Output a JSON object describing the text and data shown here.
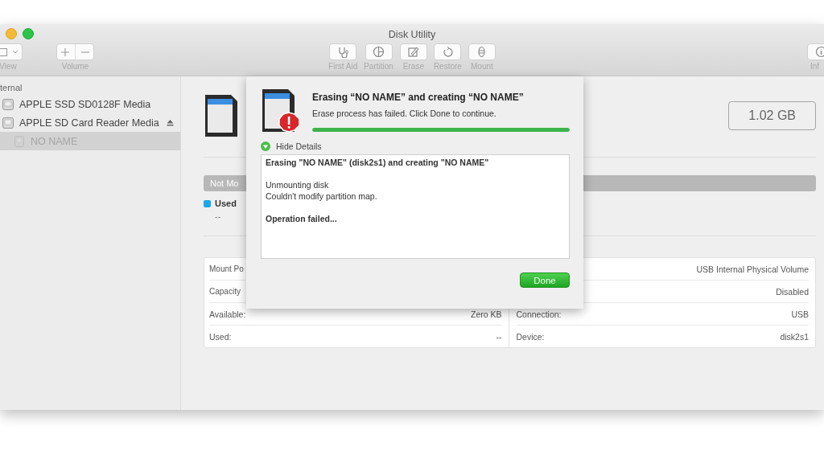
{
  "window": {
    "title": "Disk Utility"
  },
  "toolbar": {
    "left": [
      {
        "kind": "view",
        "label": "View"
      },
      {
        "kind": "volume",
        "label": "Volume"
      }
    ],
    "center": [
      {
        "label": "First Aid"
      },
      {
        "label": "Partition"
      },
      {
        "label": "Erase"
      },
      {
        "label": "Restore"
      },
      {
        "label": "Mount"
      }
    ],
    "right": [
      {
        "label": "Inf"
      }
    ]
  },
  "sidebar": {
    "items": [
      {
        "kind": "header",
        "label": "ternal"
      },
      {
        "kind": "disk",
        "label": "APPLE SSD SD0128F Media",
        "ejectable": false,
        "selected": false,
        "dimmed": false
      },
      {
        "kind": "disk",
        "label": "APPLE SD Card Reader Media",
        "ejectable": true,
        "selected": false,
        "dimmed": false,
        "children": [
          {
            "kind": "volume",
            "label": "NO NAME",
            "ejectable": false,
            "selected": true,
            "dimmed": true
          }
        ]
      }
    ]
  },
  "volume": {
    "capacity": "1.02 GB",
    "usage_bar_label": "Not Mo",
    "legend": [
      {
        "label": "Used",
        "value": "--",
        "color": "#1aa7ec"
      }
    ]
  },
  "info": {
    "left": [
      {
        "label": "Mount Po"
      },
      {
        "label": "Capacity"
      },
      {
        "label": "Available:",
        "value": "Zero KB"
      },
      {
        "label": "Used:",
        "value": "--"
      }
    ],
    "right": [
      {
        "value": "USB Internal Physical Volume"
      },
      {
        "value": "Disabled"
      },
      {
        "label": "Connection:",
        "value": "USB"
      },
      {
        "label": "Device:",
        "value": "disk2s1"
      }
    ]
  },
  "dialog": {
    "title": "Erasing “NO NAME” and creating “NO NAME”",
    "message": "Erase process has failed. Click Done to continue.",
    "level": 1,
    "details_toggle": {
      "label": "Hide Details",
      "expanded": true
    },
    "details": [
      {
        "bold": true,
        "lines": [
          "Erasing \"NO NAME\" (disk2s1) and creating \"NO NAME\""
        ]
      },
      {
        "bold": false,
        "lines": [
          "Unmounting disk",
          "Couldn't modify partition map."
        ]
      },
      {
        "bold": true,
        "lines": [
          "Operation failed..."
        ]
      }
    ],
    "button": "Done"
  }
}
